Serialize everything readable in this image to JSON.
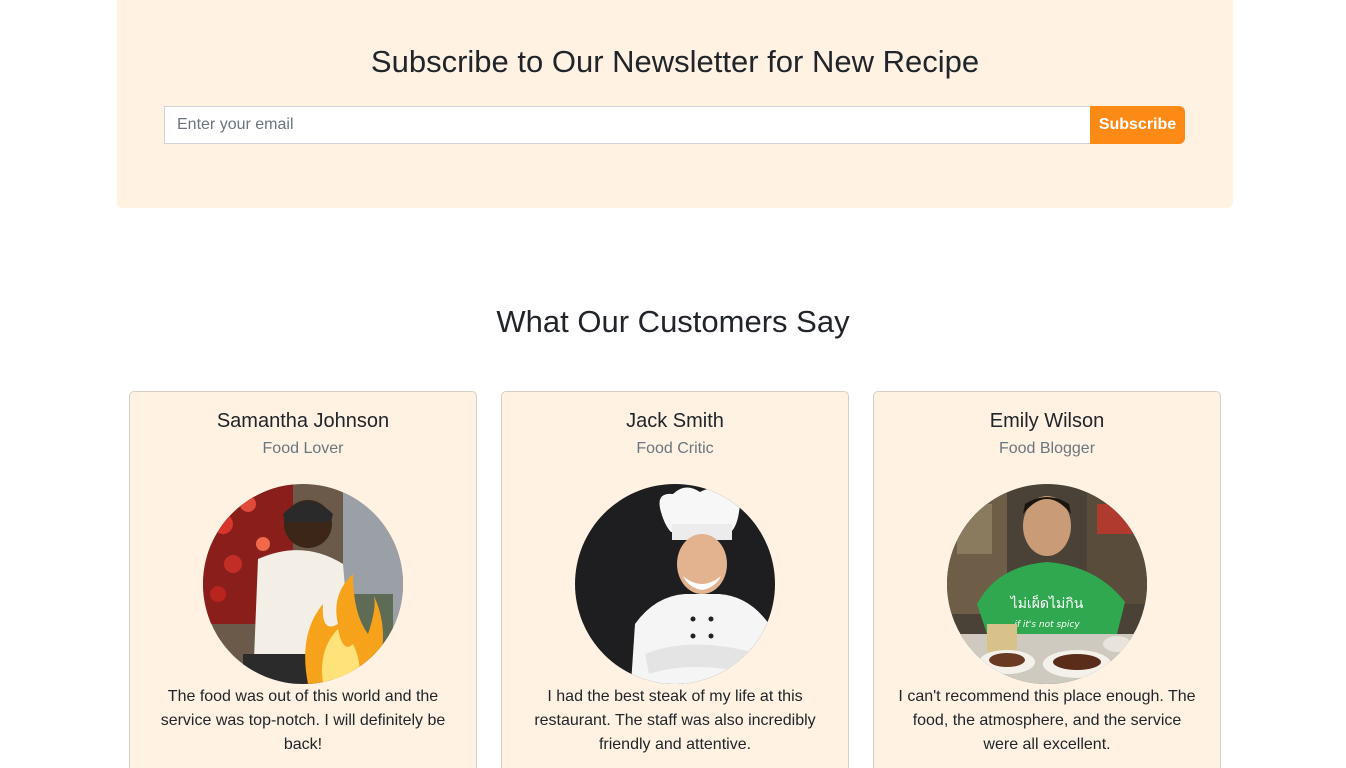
{
  "newsletter": {
    "title": "Subscribe to Our Newsletter for New Recipe",
    "email_placeholder": "Enter your email",
    "subscribe_label": "Subscribe",
    "background": "#fff2e2",
    "button_color": "#fd8a14"
  },
  "testimonials": {
    "title": "What Our Customers Say",
    "items": [
      {
        "name": "Samantha Johnson",
        "role": "Food Lover",
        "quote": "The food was out of this world and the service was top-notch. I will definitely be back!",
        "photo": "chef-flambe-photo"
      },
      {
        "name": "Jack Smith",
        "role": "Food Critic",
        "quote": "I had the best steak of my life at this restaurant. The staff was also incredibly friendly and attentive.",
        "photo": "chef-white-uniform-photo"
      },
      {
        "name": "Emily Wilson",
        "role": "Food Blogger",
        "quote": "I can't recommend this place enough. The food, the atmosphere, and the service were all excellent.",
        "photo": "man-green-shirt-dining-photo",
        "shirt_text": "ไม่เผ็ดไม่กิน",
        "shirt_subtext": "if it's not spicy"
      }
    ]
  }
}
